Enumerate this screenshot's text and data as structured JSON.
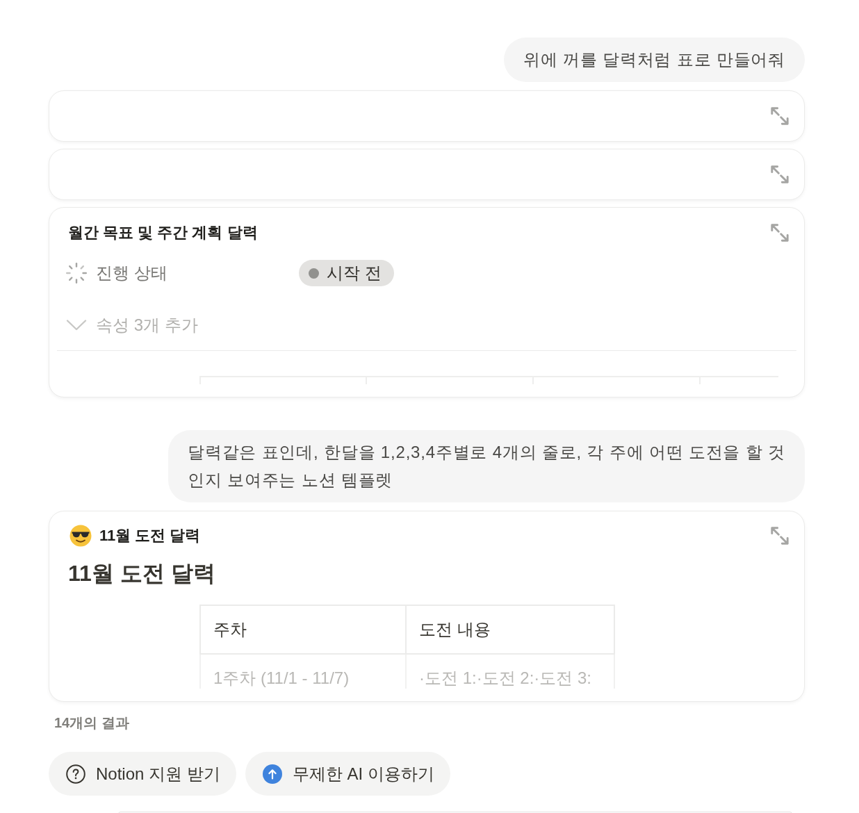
{
  "conversation": [
    {
      "kind": "user_message",
      "text": "위에 꺼를 달력처럼 표로 만들어줘"
    },
    {
      "kind": "empty_page_card"
    },
    {
      "kind": "empty_page_card"
    },
    {
      "kind": "database_page_card",
      "title": "월간 목표 및 주간 계획 달력",
      "properties": [
        {
          "name": "진행 상태",
          "value": "시작 전",
          "color": "#91918e"
        }
      ],
      "more_properties": "속성 3개 추가"
    },
    {
      "kind": "user_message",
      "text": "달력같은 표인데, 한달을 1,2,3,4주별로 4개의 줄로, 각 주에 어떤 도전을 할 것인지 보여주는 노션 템플렛"
    },
    {
      "kind": "document_page_card",
      "title": "11월 도전 달력",
      "heading": "11월 도전 달력",
      "table": {
        "columns": [
          "주차",
          "도전 내용"
        ],
        "rows": [
          [
            "1주차 (11/1 - 11/7)",
            "·도전 1:·도전 2:·도전 3:"
          ]
        ]
      }
    }
  ],
  "results_count": "14개의 결과",
  "actions": [
    {
      "kind": "help",
      "label": "Notion 지원 받기"
    },
    {
      "kind": "upgrade",
      "label": "무제한 AI 이용하기"
    }
  ]
}
